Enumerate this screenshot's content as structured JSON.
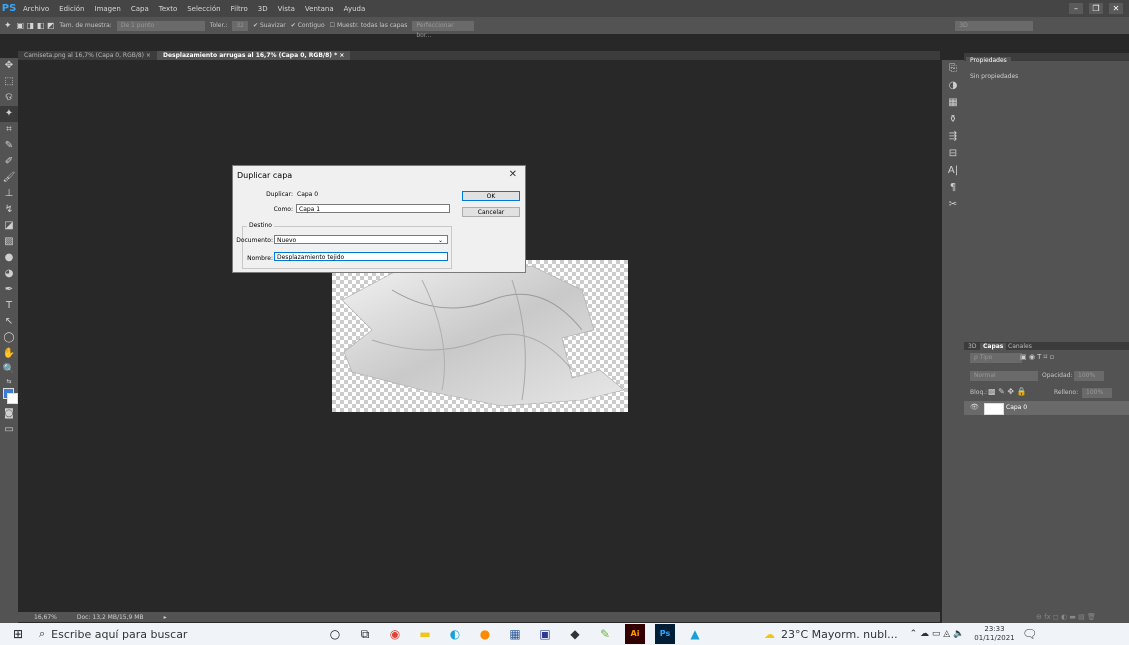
{
  "app": {
    "logo": "PS"
  },
  "menu": [
    "Archivo",
    "Edición",
    "Imagen",
    "Capa",
    "Texto",
    "Selección",
    "Filtro",
    "3D",
    "Vista",
    "Ventana",
    "Ayuda"
  ],
  "options": {
    "sample_size_label": "Tam. de muestra:",
    "sample_size_value": "De 1 punto",
    "tolerance_label": "Toler.:",
    "tolerance_value": "32",
    "smooth": "Suavizar",
    "contiguous": "Contiguo",
    "sample_all": "Muestr. todas las capas",
    "refine": "Perfeccionar bor...",
    "workspace": "3D"
  },
  "tabs": [
    "Camiseta.png al 16,7% (Capa 0, RGB/8) ×",
    "Desplazamiento arrugas al 16,7% (Capa 0, RGB/8) * ×"
  ],
  "status": {
    "zoom": "16,67%",
    "doc": "Doc: 13,2 MB/15,9 MB"
  },
  "properties": {
    "tab": "Propiedades",
    "empty": "Sin propiedades"
  },
  "layers": {
    "tabs": [
      "3D",
      "Capas",
      "Canales"
    ],
    "filter": "ρ Tipo",
    "blend": "Normal",
    "opacity_label": "Opacidad:",
    "opacity_value": "100%",
    "lock_label": "Bloq.:",
    "fill_label": "Relleno:",
    "fill_value": "100%",
    "layer_name": "Capa 0"
  },
  "dialog": {
    "title": "Duplicar capa",
    "duplicate_label": "Duplicar:",
    "duplicate_value": "Capa 0",
    "as_label": "Como:",
    "as_value": "Capa 1",
    "group": "Destino",
    "doc_label": "Documento:",
    "doc_value": "Nuevo",
    "name_label": "Nombre:",
    "name_value": "Desplazamiento tejido",
    "ok": "OK",
    "cancel": "Cancelar"
  },
  "taskbar": {
    "search": "Escribe aquí para buscar",
    "weather": "23°C Mayorm. nubl...",
    "time": "23:33",
    "date": "01/11/2021"
  }
}
